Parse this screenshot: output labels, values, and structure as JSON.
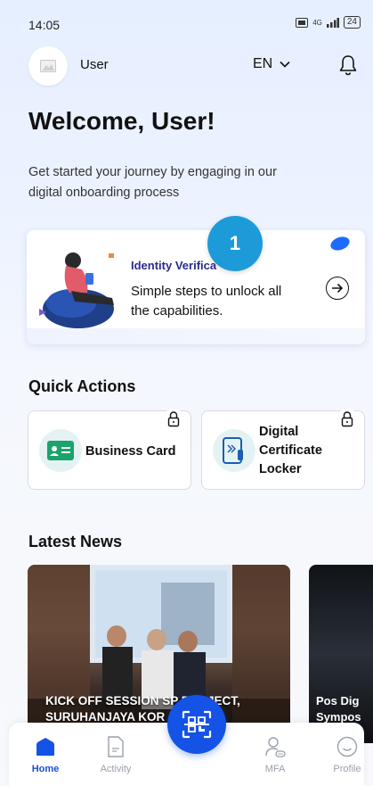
{
  "status_bar": {
    "time": "14:05",
    "network": "4G",
    "battery": "24"
  },
  "header": {
    "user_name": "User",
    "language": "EN"
  },
  "welcome": {
    "title": "Welcome, User!",
    "subtitle": "Get started your journey by engaging in our digital onboarding process"
  },
  "identity_card": {
    "title": "Identity Verifica",
    "description": "Simple steps to unlock all the capabilities.",
    "step_badge": "1"
  },
  "quick_actions": {
    "title": "Quick Actions",
    "items": [
      {
        "label": "Business Card",
        "icon": "business-card-icon",
        "locked": true
      },
      {
        "label_lines": [
          "Digital",
          "Certificate",
          "Locker"
        ],
        "icon": "certificate-locker-icon",
        "locked": true
      }
    ]
  },
  "latest_news": {
    "title": "Latest News",
    "items": [
      {
        "caption_line1": "KICK OFF SESSION SP  PROJECT,",
        "caption_line2": "SURUHANJAYA KOR       ALAY..."
      },
      {
        "caption_line1": "Pos Dig",
        "caption_line2": "Sympos"
      }
    ]
  },
  "bottom_nav": {
    "items": [
      {
        "label": "Home",
        "active": true
      },
      {
        "label": "Activity",
        "active": false
      },
      {
        "label": "MFA",
        "active": false
      },
      {
        "label": "Profile",
        "active": false
      }
    ]
  },
  "colors": {
    "accent": "#1453e6",
    "badge": "#1d9bd8",
    "title_blue": "#2a2a8e"
  }
}
